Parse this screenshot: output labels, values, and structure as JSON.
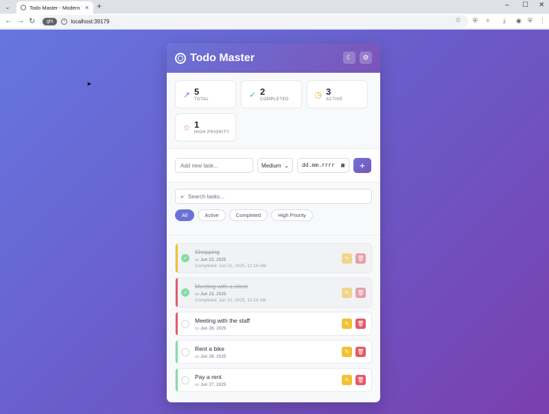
{
  "browser": {
    "tab_title": "Todo Master - Modern Task Mana",
    "url": "localhost:39179",
    "incognito_label": "ghi"
  },
  "app": {
    "title": "Todo Master"
  },
  "stats": [
    {
      "value": "5",
      "label": "TOTAL",
      "icon": "trend-icon",
      "color": "#7b7fdc"
    },
    {
      "value": "2",
      "label": "COMPLETED",
      "icon": "check-icon",
      "color": "#3bc46b"
    },
    {
      "value": "3",
      "label": "ACTIVE",
      "icon": "clock-icon",
      "color": "#f0a81a"
    },
    {
      "value": "1",
      "label": "HIGH PRIORITY",
      "icon": "star-icon",
      "color": "#e35a67"
    }
  ],
  "add": {
    "placeholder": "Add new task...",
    "priority": "Medium",
    "date_placeholder": "dd.mm.rrrr",
    "add_symbol": "+"
  },
  "search": {
    "placeholder": "Search tasks..."
  },
  "filters": [
    "All",
    "Active",
    "Completed",
    "High Priority"
  ],
  "tasks": [
    {
      "title": "Shopping",
      "date": "Jun 22, 2025",
      "completed_text": "Completed: Jun 21, 2025, 12:16 AM",
      "done": true,
      "priority_color": "#f2c033"
    },
    {
      "title": "Meeting with a client",
      "date": "Jun 23, 2025",
      "completed_text": "Completed: Jun 21, 2025, 12:16 AM",
      "done": true,
      "priority_color": "#e35a67"
    },
    {
      "title": "Meeting with the staff",
      "date": "Jun 26, 2025",
      "completed_text": "",
      "done": false,
      "priority_color": "#e35a67"
    },
    {
      "title": "Rent a bike",
      "date": "Jun 28, 2025",
      "completed_text": "",
      "done": false,
      "priority_color": "#86dba5"
    },
    {
      "title": "Pay a rent",
      "date": "Jun 27, 2025",
      "completed_text": "",
      "done": false,
      "priority_color": "#86dba5"
    }
  ]
}
